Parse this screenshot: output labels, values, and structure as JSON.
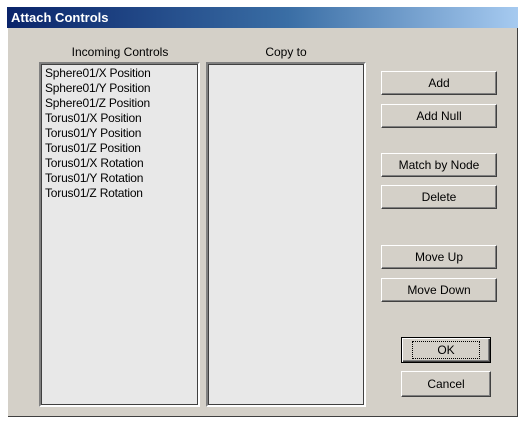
{
  "window": {
    "title": "Attach Controls"
  },
  "incoming": {
    "label": "Incoming Controls",
    "items": [
      "Sphere01/X Position",
      "Sphere01/Y Position",
      "Sphere01/Z Position",
      "Torus01/X Position",
      "Torus01/Y Position",
      "Torus01/Z Position",
      "Torus01/X Rotation",
      "Torus01/Y Rotation",
      "Torus01/Z Rotation"
    ]
  },
  "copy_to": {
    "label": "Copy to",
    "items": []
  },
  "buttons": {
    "add": "Add",
    "add_null": "Add Null",
    "match_by_node": "Match by Node",
    "delete": "Delete",
    "move_up": "Move Up",
    "move_down": "Move Down",
    "ok": "OK",
    "cancel": "Cancel"
  }
}
